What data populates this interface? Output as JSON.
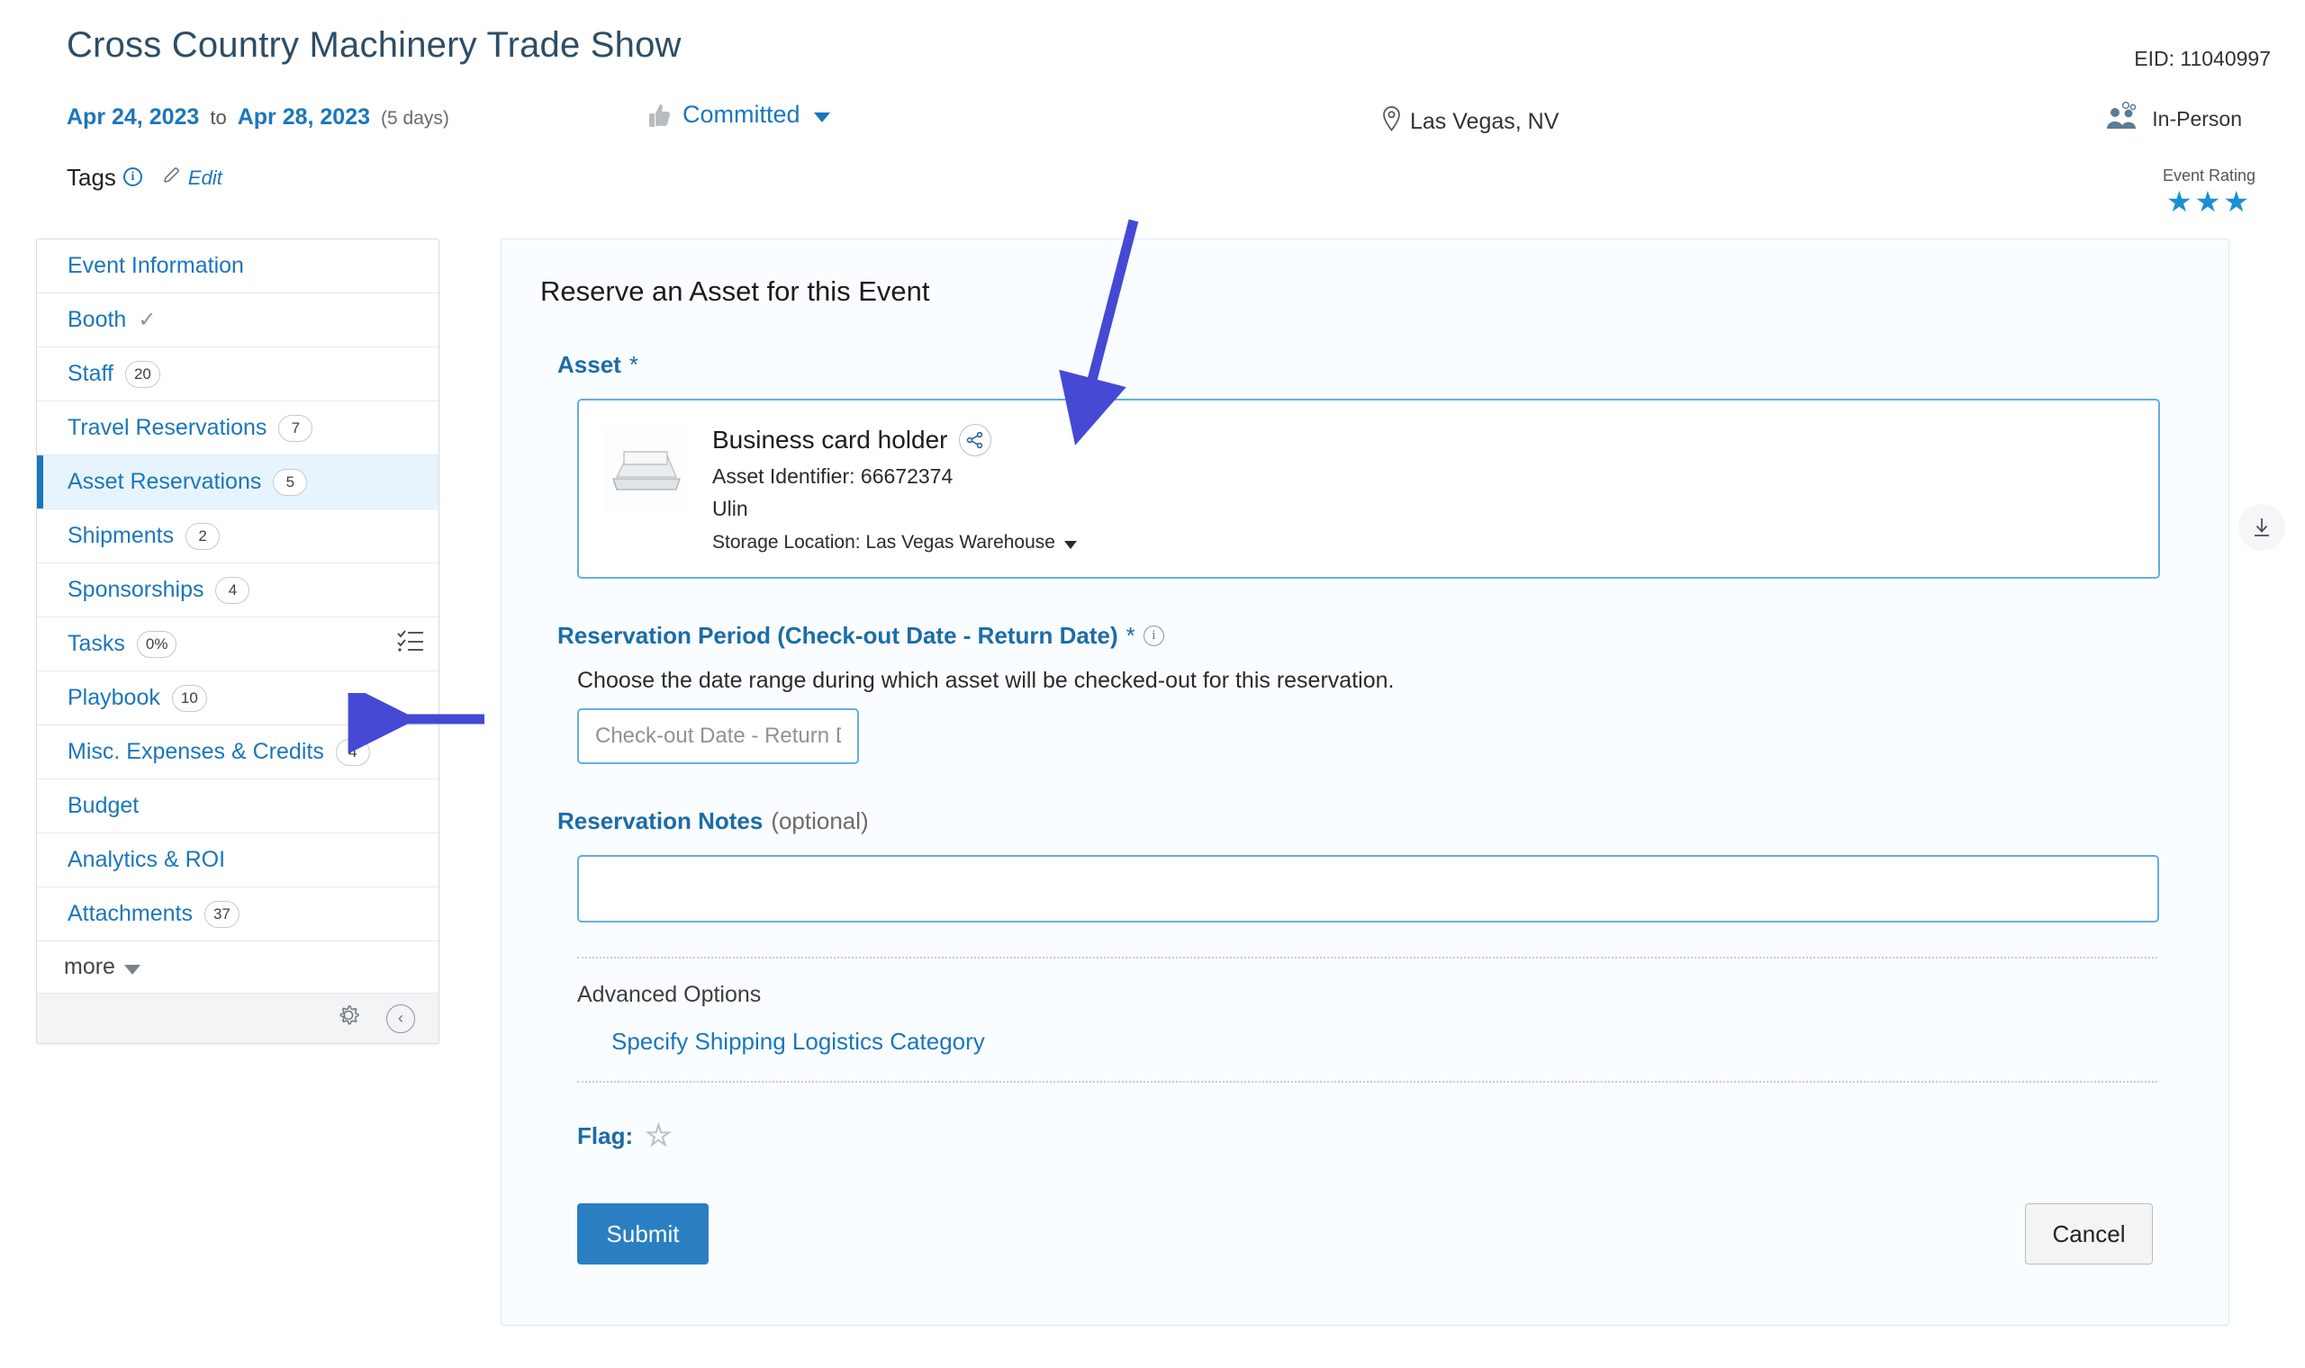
{
  "header": {
    "title": "Cross Country Machinery Trade Show",
    "eid": "EID: 11040997",
    "start_date": "Apr 24, 2023",
    "to_label": "to",
    "end_date": "Apr 28, 2023",
    "duration": "(5 days)",
    "status": "Committed",
    "location": "Las Vegas, NV",
    "mode": "In-Person",
    "rating_label": "Event Rating",
    "rating_stars": "★★★",
    "rating_value": 3,
    "tags_label": "Tags",
    "edit_label": "Edit",
    "accent_color": "#1b76bc",
    "star_color": "#1b8fd4"
  },
  "sidebar": {
    "items": [
      {
        "label": "Event Information",
        "badge": "",
        "active": false
      },
      {
        "label": "Booth",
        "badge": "",
        "check": true,
        "active": false
      },
      {
        "label": "Staff",
        "badge": "20",
        "active": false
      },
      {
        "label": "Travel Reservations",
        "badge": "7",
        "active": false
      },
      {
        "label": "Asset Reservations",
        "badge": "5",
        "active": true
      },
      {
        "label": "Shipments",
        "badge": "2",
        "active": false
      },
      {
        "label": "Sponsorships",
        "badge": "4",
        "active": false
      },
      {
        "label": "Tasks",
        "badge": "0%",
        "active": false
      },
      {
        "label": "Playbook",
        "badge": "10",
        "active": false
      },
      {
        "label": "Misc. Expenses & Credits",
        "badge": "4",
        "active": false
      },
      {
        "label": "Budget",
        "badge": "",
        "active": false
      },
      {
        "label": "Analytics & ROI",
        "badge": "",
        "active": false
      },
      {
        "label": "Attachments",
        "badge": "37",
        "active": false
      }
    ],
    "more_label": "more"
  },
  "main": {
    "panel_title": "Reserve an Asset for this Event",
    "asset_label": "Asset",
    "asset_required": "*",
    "asset": {
      "name": "Business card holder",
      "identifier": "Asset Identifier: 66672374",
      "owner": "Ulin",
      "storage": "Storage Location: Las Vegas Warehouse"
    },
    "period_label": "Reservation Period (Check-out Date - Return Date)",
    "period_required": "*",
    "period_help": "Choose the date range during which asset will be checked-out for this reservation.",
    "date_placeholder": "Check-out Date - Return Date",
    "date_value": "",
    "notes_label": "Reservation Notes",
    "notes_optional": "(optional)",
    "notes_value": "",
    "advanced_label": "Advanced Options",
    "shipping_link": "Specify Shipping Logistics Category",
    "flag_label": "Flag:",
    "flag_star": "☆",
    "submit_label": "Submit",
    "cancel_label": "Cancel"
  }
}
